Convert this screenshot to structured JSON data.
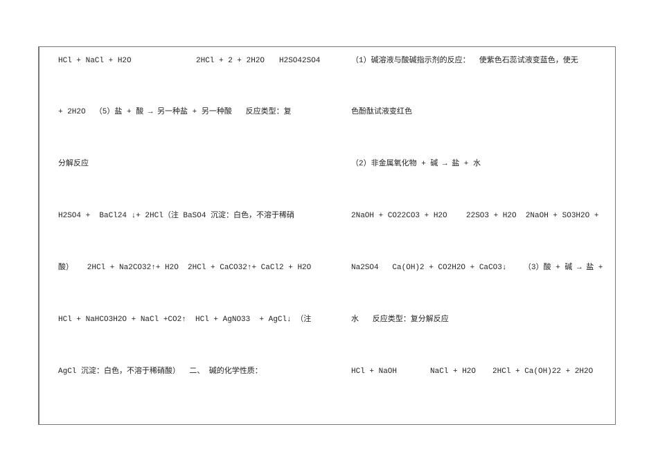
{
  "left_column": {
    "lines": [
      [
        "HCl + NaCl + H2O",
        "2HCl + 2 + 2H2O",
        "H2SO42SO4"
      ],
      [
        "+ 2H2O  （5）盐 + 酸 → 另一种盐 + 另一种酸   反应类型：复"
      ],
      [
        "分解反应"
      ],
      [
        "H2SO4 +  BaCl24 ↓+ 2HCl（注 BaSO4 沉淀：白色，不溶于稀硝"
      ],
      [
        "酸）   2HCl + Na2CO32↑+ H2O  2HCl + CaCO32↑+ CaCl2 + H2O"
      ],
      [
        "HCl + NaHCO3H2O + NaCl +CO2↑  HCl + AgNO33  + AgCl↓ （注"
      ],
      [
        "AgCl 沉淀：白色，不溶于稀硝酸）  二、 碱的化学性质："
      ]
    ]
  },
  "right_column": {
    "lines": [
      [
        "（1）碱溶液与酸碱指示剂的反应：  使紫色石蕊试液变蓝色，使无"
      ],
      [
        "色酚酞试液变红色"
      ],
      [
        "（2）非金属氧化物 + 碱 → 盐 + 水"
      ],
      [
        "2NaOH + CO22CO3 + H2O",
        "22SO3 + H2O  2NaOH + SO3H2O +"
      ],
      [
        "Na2SO4   Ca(OH)2 + CO2H2O + CaCO3↓",
        "（3）酸 + 碱 → 盐 +"
      ],
      [
        "水   反应类型：复分解反应"
      ],
      [
        "HCl + NaOH",
        "NaCl + H2O",
        "2HCl + Ca(OH)22 + 2H2O"
      ]
    ]
  }
}
